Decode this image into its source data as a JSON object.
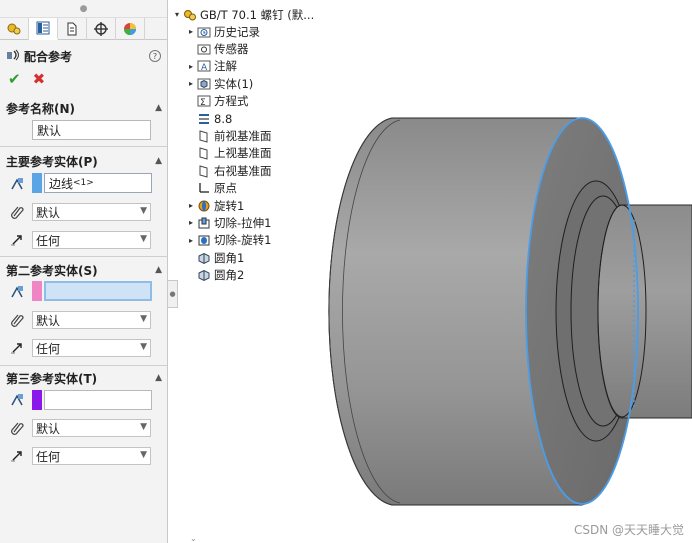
{
  "property_manager": {
    "tabs": [
      "feature-manager-icon",
      "property-manager-icon",
      "configuration-manager-icon",
      "dimxpert-icon",
      "display-manager-icon"
    ],
    "title": "配合参考",
    "help": "?",
    "ok_glyph": "✔",
    "cancel_glyph": "✖",
    "reference_name": {
      "header": "参考名称(N)",
      "value": "默认"
    },
    "primary": {
      "header": "主要参考实体(P)",
      "entity_value": "边线",
      "entity_suffix": "<1>",
      "swatch_color": "#5aa5e6",
      "type_value": "默认",
      "alignment_value": "任何"
    },
    "secondary": {
      "header": "第二参考实体(S)",
      "entity_value": "",
      "swatch_color": "#ef86c3",
      "type_value": "默认",
      "alignment_value": "任何"
    },
    "tertiary": {
      "header": "第三参考实体(T)",
      "entity_value": "",
      "swatch_color": "#8a18e8",
      "type_value": "默认",
      "alignment_value": "任何"
    }
  },
  "tree": {
    "root": "GB/T 70.1 螺钉 (默...",
    "items": [
      {
        "label": "历史记录",
        "icon": "history-folder-icon",
        "expandable": true
      },
      {
        "label": "传感器",
        "icon": "sensor-icon",
        "expandable": false
      },
      {
        "label": "注解",
        "icon": "annotation-icon",
        "expandable": true
      },
      {
        "label": "实体(1)",
        "icon": "solid-bodies-icon",
        "expandable": true
      },
      {
        "label": "方程式",
        "icon": "equations-icon",
        "expandable": false
      },
      {
        "label": "8.8",
        "icon": "material-icon",
        "expandable": false
      },
      {
        "label": "前视基准面",
        "icon": "plane-icon",
        "expandable": false
      },
      {
        "label": "上视基准面",
        "icon": "plane-icon",
        "expandable": false
      },
      {
        "label": "右视基准面",
        "icon": "plane-icon",
        "expandable": false
      },
      {
        "label": "原点",
        "icon": "origin-icon",
        "expandable": false
      },
      {
        "label": "旋转1",
        "icon": "revolve-icon",
        "expandable": true
      },
      {
        "label": "切除-拉伸1",
        "icon": "cut-extrude-icon",
        "expandable": true
      },
      {
        "label": "切除-旋转1",
        "icon": "cut-revolve-icon",
        "expandable": true
      },
      {
        "label": "圆角1",
        "icon": "fillet-icon",
        "expandable": false
      },
      {
        "label": "圆角2",
        "icon": "fillet-icon",
        "expandable": false
      }
    ]
  },
  "watermark": "CSDN @天天睡大觉",
  "colors": {
    "selection_edge": "#4a9de8",
    "model_body": "#8c8c8c"
  }
}
